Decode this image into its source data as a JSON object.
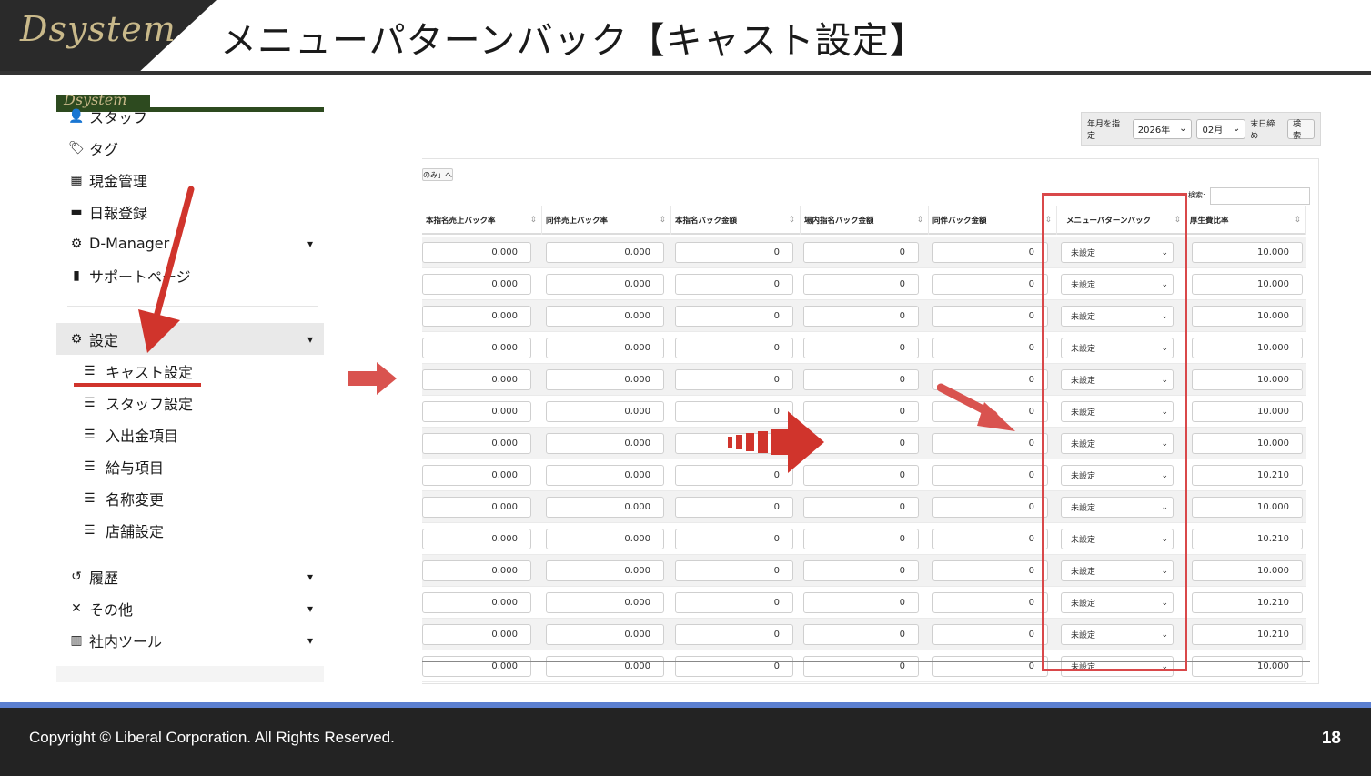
{
  "header": {
    "logo_text": "Dsystem",
    "title": "メニューパターンバック【キャスト設定】"
  },
  "sidebar": {
    "items": [
      {
        "icon": "person-icon",
        "glyph": "👤",
        "label": "スタッフ"
      },
      {
        "icon": "tags-icon",
        "glyph": "🏷",
        "label": "タグ"
      },
      {
        "icon": "calculator-icon",
        "glyph": "▦",
        "label": "現金管理"
      },
      {
        "icon": "calendar-icon",
        "glyph": "▬",
        "label": "日報登録"
      },
      {
        "icon": "gear-icon",
        "glyph": "⚙",
        "label": "D-Manager",
        "chevron": true
      },
      {
        "icon": "file-icon",
        "glyph": "▮",
        "label": "サポートページ"
      }
    ],
    "settings": {
      "icon": "gears-icon",
      "glyph": "⚙",
      "label": "設定"
    },
    "sub_items": [
      {
        "label": "キャスト設定"
      },
      {
        "label": "スタッフ設定"
      },
      {
        "label": "入出金項目"
      },
      {
        "label": "給与項目"
      },
      {
        "label": "名称変更"
      },
      {
        "label": "店舗設定"
      }
    ],
    "lower_items": [
      {
        "icon": "history-icon",
        "glyph": "↺",
        "label": "履歴"
      },
      {
        "icon": "tools-icon",
        "glyph": "✕",
        "label": "その他"
      },
      {
        "icon": "building-icon",
        "glyph": "▥",
        "label": "社内ツール"
      }
    ]
  },
  "filter": {
    "label": "年月を指定",
    "year": "2026年",
    "month": "02月",
    "closing_label": "末日締め",
    "search_button": "検索"
  },
  "table": {
    "toggle_label": "のみ」へ",
    "search_label": "検索:",
    "columns": [
      "本指名売上バック率",
      "同伴売上バック率",
      "本指名バック金額",
      "場内指名バック金額",
      "同伴バック金額",
      "メニューパターンバック",
      "厚生費比率"
    ],
    "rows": [
      [
        "0.000",
        "0.000",
        "0",
        "0",
        "0",
        "未設定",
        "10.000"
      ],
      [
        "0.000",
        "0.000",
        "0",
        "0",
        "0",
        "未設定",
        "10.000"
      ],
      [
        "0.000",
        "0.000",
        "0",
        "0",
        "0",
        "未設定",
        "10.000"
      ],
      [
        "0.000",
        "0.000",
        "0",
        "0",
        "0",
        "未設定",
        "10.000"
      ],
      [
        "0.000",
        "0.000",
        "0",
        "0",
        "0",
        "未設定",
        "10.000"
      ],
      [
        "0.000",
        "0.000",
        "0",
        "0",
        "0",
        "未設定",
        "10.000"
      ],
      [
        "0.000",
        "0.000",
        "0",
        "0",
        "0",
        "未設定",
        "10.000"
      ],
      [
        "0.000",
        "0.000",
        "0",
        "0",
        "0",
        "未設定",
        "10.210"
      ],
      [
        "0.000",
        "0.000",
        "0",
        "0",
        "0",
        "未設定",
        "10.000"
      ],
      [
        "0.000",
        "0.000",
        "0",
        "0",
        "0",
        "未設定",
        "10.210"
      ],
      [
        "0.000",
        "0.000",
        "0",
        "0",
        "0",
        "未設定",
        "10.000"
      ],
      [
        "0.000",
        "0.000",
        "0",
        "0",
        "0",
        "未設定",
        "10.210"
      ],
      [
        "0.000",
        "0.000",
        "0",
        "0",
        "0",
        "未設定",
        "10.210"
      ],
      [
        "0.000",
        "0.000",
        "0",
        "0",
        "0",
        "未設定",
        "10.000"
      ]
    ]
  },
  "footer": {
    "copyright": "Copyright ©  Liberal Corporation. All Rights Reserved.",
    "page_number": "18"
  },
  "colors": {
    "accent_red": "#d0342c",
    "footer_bg": "#232323",
    "footer_accent": "#5b7fd0",
    "sidebar_header": "#2d4a1f"
  }
}
